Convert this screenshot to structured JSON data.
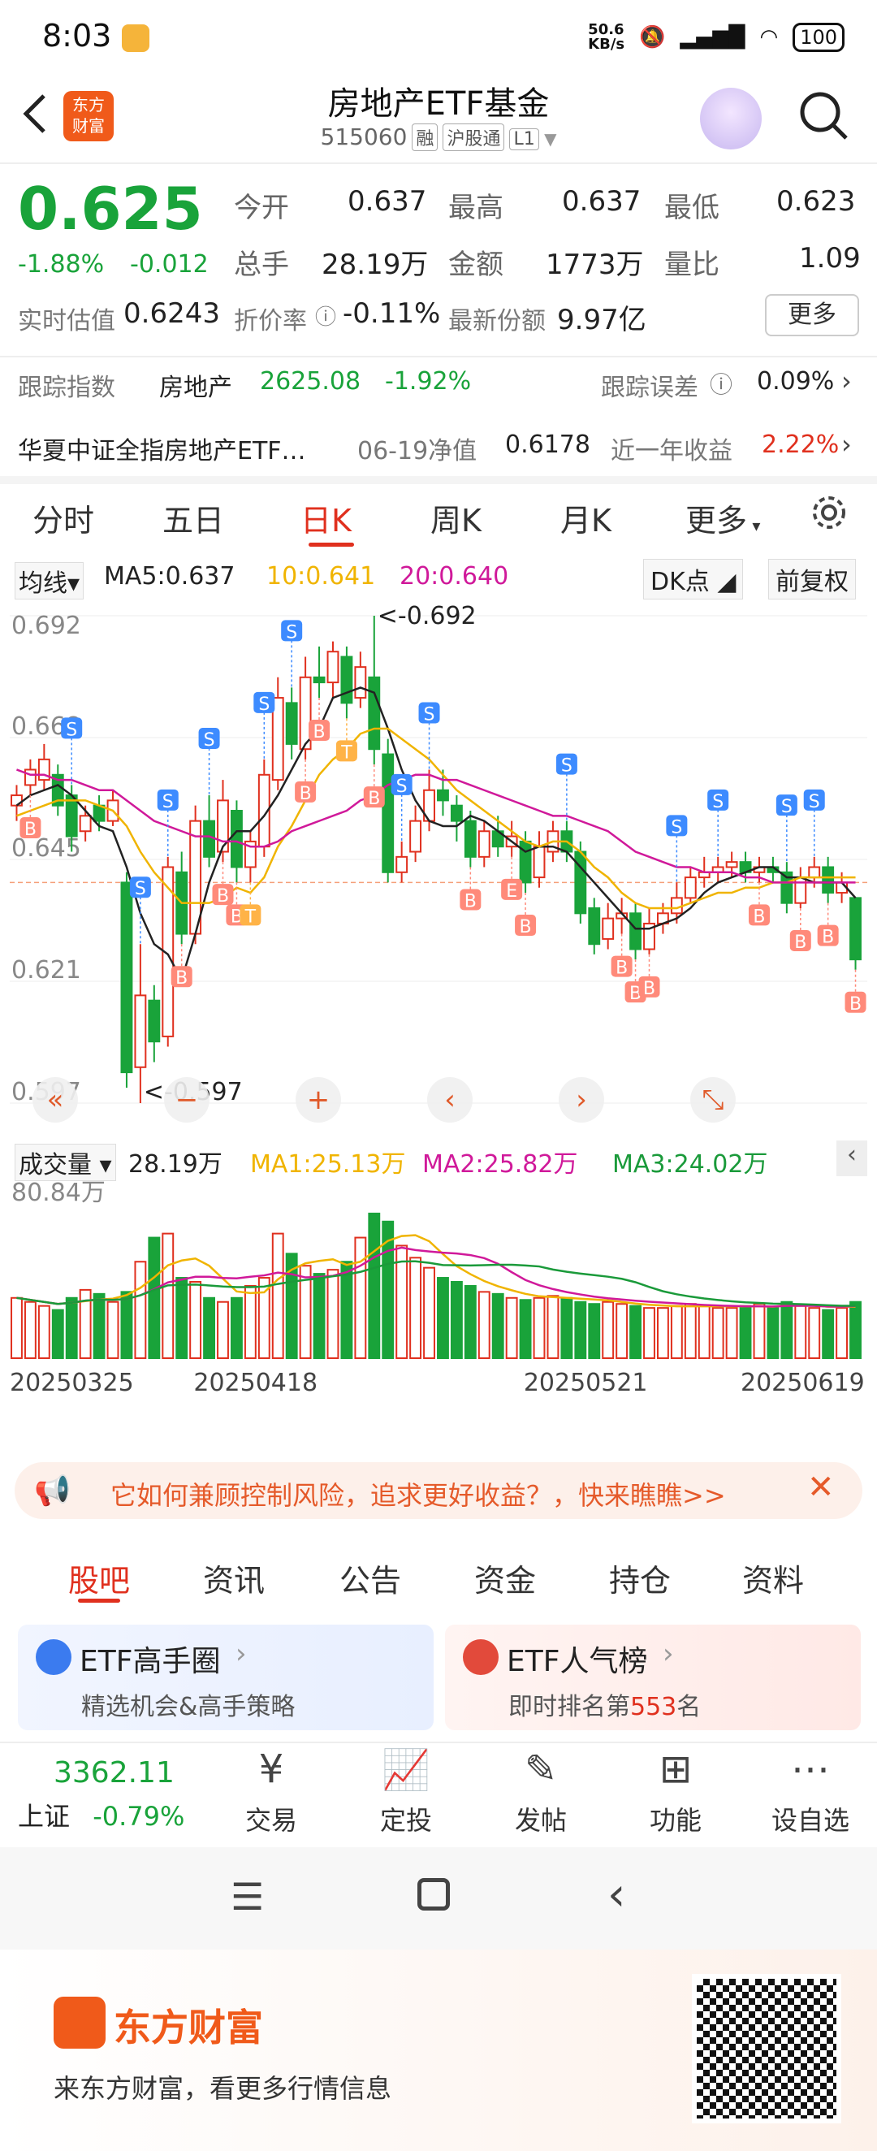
{
  "status": {
    "time": "8:03",
    "net_speed": "50.6\nKB/s",
    "battery": "100"
  },
  "header": {
    "title": "房地产ETF基金",
    "code": "515060",
    "tags": [
      "融",
      "沪股通",
      "L1"
    ],
    "logo": "东方\n财富"
  },
  "quote": {
    "price": "0.625",
    "change_pct": "-1.88%",
    "change": "-0.012",
    "open_label": "今开",
    "open": "0.637",
    "high_label": "最高",
    "high": "0.637",
    "low_label": "最低",
    "low": "0.623",
    "vol_label": "总手",
    "vol": "28.19万",
    "amount_label": "金额",
    "amount": "1773万",
    "ratio_label": "量比",
    "ratio": "1.09",
    "est_label": "实时估值",
    "est": "0.6243",
    "discount_label": "折价率",
    "discount": "-0.11%",
    "shares_label": "最新份额",
    "shares": "9.97亿",
    "more": "更多"
  },
  "tracking": {
    "index_label": "跟踪指数",
    "index_name": "房地产",
    "index_value": "2625.08",
    "index_pct": "-1.92%",
    "err_label": "跟踪误差",
    "err": "0.09%",
    "fund_name": "华夏中证全指房地产ETF…",
    "nav_label": "06-19净值",
    "nav": "0.6178",
    "year_label": "近一年收益",
    "year": "2.22%"
  },
  "ktabs": [
    "分时",
    "五日",
    "日K",
    "周K",
    "月K",
    "更多",
    "settings"
  ],
  "ma_bar": {
    "mode": "均线",
    "ma5": "MA5:0.637",
    "ma10": "10:0.641",
    "ma20": "20:0.640",
    "dk": "DK点",
    "adj": "前复权"
  },
  "chart_data": {
    "type": "candlestick",
    "ylim": [
      0.597,
      0.692
    ],
    "y_ticks": [
      "0.692",
      "0.668",
      "0.645",
      "0.621",
      "0.597"
    ],
    "max_label": "<-0.692",
    "min_label": "<-0.597",
    "x_ticks": [
      "20250325",
      "20250418",
      "20250521",
      "20250619"
    ],
    "candles": [
      [
        0.655,
        0.657,
        0.659,
        0.652
      ],
      [
        0.659,
        0.662,
        0.664,
        0.657
      ],
      [
        0.66,
        0.664,
        0.667,
        0.658
      ],
      [
        0.661,
        0.655,
        0.663,
        0.653
      ],
      [
        0.657,
        0.649,
        0.659,
        0.646
      ],
      [
        0.65,
        0.653,
        0.655,
        0.648
      ],
      [
        0.655,
        0.652,
        0.657,
        0.65
      ],
      [
        0.652,
        0.656,
        0.658,
        0.651
      ],
      [
        0.64,
        0.603,
        0.642,
        0.6
      ],
      [
        0.604,
        0.618,
        0.628,
        0.597
      ],
      [
        0.617,
        0.609,
        0.62,
        0.605
      ],
      [
        0.61,
        0.643,
        0.645,
        0.608
      ],
      [
        0.642,
        0.63,
        0.646,
        0.628
      ],
      [
        0.63,
        0.652,
        0.655,
        0.628
      ],
      [
        0.652,
        0.645,
        0.657,
        0.643
      ],
      [
        0.646,
        0.656,
        0.66,
        0.644
      ],
      [
        0.654,
        0.643,
        0.656,
        0.64
      ],
      [
        0.643,
        0.648,
        0.65,
        0.64
      ],
      [
        0.647,
        0.661,
        0.664,
        0.645
      ],
      [
        0.66,
        0.676,
        0.68,
        0.658
      ],
      [
        0.675,
        0.667,
        0.678,
        0.664
      ],
      [
        0.666,
        0.68,
        0.684,
        0.664
      ],
      [
        0.68,
        0.679,
        0.686,
        0.676
      ],
      [
        0.679,
        0.685,
        0.687,
        0.676
      ],
      [
        0.684,
        0.675,
        0.686,
        0.672
      ],
      [
        0.676,
        0.682,
        0.685,
        0.674
      ],
      [
        0.68,
        0.666,
        0.692,
        0.663
      ],
      [
        0.665,
        0.642,
        0.668,
        0.64
      ],
      [
        0.642,
        0.645,
        0.648,
        0.64
      ],
      [
        0.646,
        0.652,
        0.655,
        0.644
      ],
      [
        0.652,
        0.658,
        0.662,
        0.65
      ],
      [
        0.658,
        0.656,
        0.662,
        0.653
      ],
      [
        0.655,
        0.652,
        0.657,
        0.648
      ],
      [
        0.652,
        0.645,
        0.654,
        0.643
      ],
      [
        0.645,
        0.65,
        0.652,
        0.643
      ],
      [
        0.65,
        0.647,
        0.653,
        0.645
      ],
      [
        0.647,
        0.649,
        0.652,
        0.645
      ],
      [
        0.648,
        0.64,
        0.65,
        0.638
      ],
      [
        0.641,
        0.647,
        0.65,
        0.639
      ],
      [
        0.646,
        0.65,
        0.652,
        0.644
      ],
      [
        0.65,
        0.646,
        0.652,
        0.644
      ],
      [
        0.646,
        0.634,
        0.648,
        0.632
      ],
      [
        0.635,
        0.628,
        0.637,
        0.626
      ],
      [
        0.629,
        0.633,
        0.636,
        0.627
      ],
      [
        0.633,
        0.634,
        0.637,
        0.63
      ],
      [
        0.634,
        0.627,
        0.636,
        0.625
      ],
      [
        0.627,
        0.632,
        0.635,
        0.626
      ],
      [
        0.632,
        0.634,
        0.636,
        0.63
      ],
      [
        0.634,
        0.637,
        0.64,
        0.632
      ],
      [
        0.637,
        0.641,
        0.643,
        0.636
      ],
      [
        0.641,
        0.642,
        0.645,
        0.639
      ],
      [
        0.642,
        0.643,
        0.645,
        0.64
      ],
      [
        0.643,
        0.644,
        0.646,
        0.641
      ],
      [
        0.644,
        0.642,
        0.646,
        0.64
      ],
      [
        0.642,
        0.643,
        0.645,
        0.64
      ],
      [
        0.643,
        0.642,
        0.645,
        0.64
      ],
      [
        0.642,
        0.636,
        0.644,
        0.634
      ],
      [
        0.636,
        0.641,
        0.643,
        0.635
      ],
      [
        0.641,
        0.643,
        0.645,
        0.639
      ],
      [
        0.643,
        0.638,
        0.645,
        0.636
      ],
      [
        0.638,
        0.64,
        0.642,
        0.636
      ],
      [
        0.637,
        0.625,
        0.637,
        0.623
      ]
    ],
    "ma5": [
      0.655,
      0.657,
      0.658,
      0.659,
      0.657,
      0.654,
      0.651,
      0.65,
      0.643,
      0.634,
      0.628,
      0.626,
      0.621,
      0.63,
      0.64,
      0.647,
      0.65,
      0.65,
      0.653,
      0.657,
      0.662,
      0.667,
      0.67,
      0.676,
      0.677,
      0.678,
      0.677,
      0.67,
      0.662,
      0.656,
      0.652,
      0.651,
      0.651,
      0.653,
      0.652,
      0.65,
      0.648,
      0.646,
      0.647,
      0.647,
      0.646,
      0.643,
      0.64,
      0.637,
      0.634,
      0.631,
      0.631,
      0.632,
      0.633,
      0.635,
      0.638,
      0.64,
      0.641,
      0.642,
      0.643,
      0.643,
      0.641,
      0.641,
      0.64,
      0.64,
      0.64,
      0.637
    ],
    "ma10": [
      0.653,
      0.654,
      0.655,
      0.656,
      0.656,
      0.656,
      0.655,
      0.654,
      0.651,
      0.646,
      0.642,
      0.639,
      0.636,
      0.636,
      0.636,
      0.637,
      0.639,
      0.638,
      0.641,
      0.647,
      0.651,
      0.656,
      0.661,
      0.664,
      0.666,
      0.669,
      0.67,
      0.67,
      0.668,
      0.666,
      0.664,
      0.661,
      0.658,
      0.656,
      0.654,
      0.652,
      0.65,
      0.648,
      0.647,
      0.648,
      0.648,
      0.646,
      0.643,
      0.641,
      0.638,
      0.636,
      0.635,
      0.635,
      0.635,
      0.636,
      0.637,
      0.638,
      0.638,
      0.639,
      0.639,
      0.64,
      0.64,
      0.641,
      0.641,
      0.641,
      0.641,
      0.641
    ],
    "ma20": [
      0.662,
      0.661,
      0.661,
      0.66,
      0.66,
      0.659,
      0.658,
      0.658,
      0.656,
      0.654,
      0.652,
      0.651,
      0.65,
      0.649,
      0.649,
      0.648,
      0.648,
      0.647,
      0.647,
      0.648,
      0.65,
      0.651,
      0.652,
      0.653,
      0.654,
      0.656,
      0.657,
      0.659,
      0.66,
      0.661,
      0.661,
      0.66,
      0.66,
      0.659,
      0.658,
      0.657,
      0.656,
      0.655,
      0.654,
      0.653,
      0.653,
      0.652,
      0.651,
      0.65,
      0.648,
      0.646,
      0.645,
      0.644,
      0.643,
      0.643,
      0.642,
      0.642,
      0.642,
      0.641,
      0.641,
      0.64,
      0.64,
      0.64,
      0.64,
      0.64,
      0.64,
      0.64
    ],
    "signals": [
      {
        "i": 1,
        "type": "B"
      },
      {
        "i": 4,
        "type": "S"
      },
      {
        "i": 9,
        "type": "S"
      },
      {
        "i": 11,
        "type": "S"
      },
      {
        "i": 12,
        "type": "B"
      },
      {
        "i": 14,
        "type": "S"
      },
      {
        "i": 15,
        "type": "B"
      },
      {
        "i": 16,
        "type": "B"
      },
      {
        "i": 17,
        "type": "T"
      },
      {
        "i": 18,
        "type": "S"
      },
      {
        "i": 20,
        "type": "S"
      },
      {
        "i": 21,
        "type": "B"
      },
      {
        "i": 22,
        "type": "B"
      },
      {
        "i": 24,
        "type": "T"
      },
      {
        "i": 26,
        "type": "B"
      },
      {
        "i": 28,
        "type": "S"
      },
      {
        "i": 30,
        "type": "S"
      },
      {
        "i": 33,
        "type": "B"
      },
      {
        "i": 36,
        "type": "E"
      },
      {
        "i": 37,
        "type": "B"
      },
      {
        "i": 40,
        "type": "S"
      },
      {
        "i": 44,
        "type": "B"
      },
      {
        "i": 45,
        "type": "B"
      },
      {
        "i": 46,
        "type": "B"
      },
      {
        "i": 48,
        "type": "S"
      },
      {
        "i": 51,
        "type": "S"
      },
      {
        "i": 54,
        "type": "B"
      },
      {
        "i": 56,
        "type": "S"
      },
      {
        "i": 57,
        "type": "B"
      },
      {
        "i": 58,
        "type": "S"
      },
      {
        "i": 59,
        "type": "B"
      },
      {
        "i": 61,
        "type": "B"
      }
    ],
    "volume": {
      "label": "成交量",
      "cur": "28.19万",
      "ma1": "MA1:25.13万",
      "ma2": "MA2:25.82万",
      "ma3": "MA3:24.02万",
      "max_label": "80.84万",
      "values": [
        30,
        28,
        26,
        24,
        30,
        34,
        32,
        28,
        33,
        48,
        60,
        62,
        40,
        38,
        30,
        28,
        30,
        36,
        40,
        62,
        52,
        46,
        42,
        44,
        48,
        60,
        72,
        68,
        56,
        50,
        45,
        40,
        38,
        36,
        33,
        32,
        30,
        29,
        30,
        31,
        30,
        28,
        27,
        28,
        27,
        26,
        25,
        25,
        26,
        27,
        26,
        25,
        25,
        26,
        27,
        25,
        28,
        26,
        25,
        24,
        25,
        28
      ]
    }
  },
  "chart_controls": [
    "«",
    "−",
    "+",
    "‹",
    "›",
    "⤡"
  ],
  "ad": {
    "text": "它如何兼顾控制风险，追求更好收益？，快来瞧瞧>>"
  },
  "section_tabs": [
    "股吧",
    "资讯",
    "公告",
    "资金",
    "持仓",
    "资料"
  ],
  "cards": [
    {
      "title": "ETF高手圈",
      "sub": "精选机会&高手策略"
    },
    {
      "title": "ETF人气榜",
      "sub_pre": "即时排名第",
      "rank": "553",
      "sub_post": "名"
    }
  ],
  "bottom_nav": {
    "index_value": "3362.11",
    "index_name": "上证",
    "index_pct": "-0.79%",
    "items": [
      {
        "label": "交易",
        "icon": "¥"
      },
      {
        "label": "定投",
        "icon": "📈"
      },
      {
        "label": "发帖",
        "icon": "✎"
      },
      {
        "label": "功能",
        "icon": "⊞"
      },
      {
        "label": "设自选",
        "icon": "⋯"
      }
    ]
  },
  "footer": {
    "brand": "东方财富",
    "slogan": "来东方财富，看更多行情信息"
  },
  "colors": {
    "up": "#e0301e",
    "down": "#19a33a",
    "ma5": "#222222",
    "ma10": "#f0b400",
    "ma20": "#d0199a",
    "ma3": "#1a9a3a",
    "accent": "#f05a1a"
  }
}
